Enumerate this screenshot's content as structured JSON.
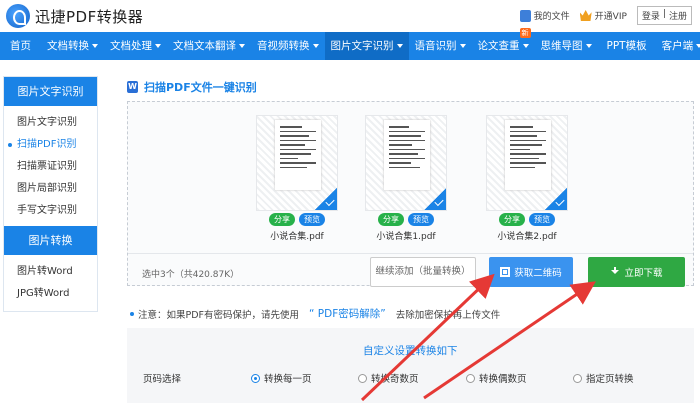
{
  "header": {
    "brand": "迅捷PDF转换器",
    "my_files": "我的文件",
    "open_vip": "开通VIP",
    "login": "登录",
    "separator": "|",
    "register": "注册"
  },
  "nav": {
    "items": [
      {
        "label": "首页"
      },
      {
        "label": "文档转换"
      },
      {
        "label": "文档处理"
      },
      {
        "label": "文档文本翻译"
      },
      {
        "label": "音视频转换"
      },
      {
        "label": "图片文字识别"
      },
      {
        "label": "语音识别"
      },
      {
        "label": "论文查重"
      },
      {
        "label": "思维导图"
      },
      {
        "label": "PPT模板"
      },
      {
        "label": "客户端"
      }
    ],
    "new_badge": "新"
  },
  "sidebar": {
    "group1_title": "图片文字识别",
    "group1_items": [
      "图片文字识别",
      "扫描PDF识别",
      "扫描票证识别",
      "图片局部识别",
      "手写文字识别"
    ],
    "group2_title": "图片转换",
    "group2_items": [
      "图片转Word",
      "JPG转Word"
    ]
  },
  "main": {
    "title": "扫描PDF文件一键识别",
    "title_icon": "W",
    "files": [
      {
        "name": "小说合集.pdf",
        "share": "分享",
        "preview": "预览"
      },
      {
        "name": "小说合集1.pdf",
        "share": "分享",
        "preview": "预览"
      },
      {
        "name": "小说合集2.pdf",
        "share": "分享",
        "preview": "预览"
      }
    ],
    "selected_text": "选中3个（共420.87K）",
    "continue_add": "继续添加（批量转换）",
    "get_qr": "获取二维码",
    "download": "立即下载"
  },
  "notice": {
    "prefix": "注意：如果PDF有密码保护，请先使用",
    "link": "“ PDF密码解除”",
    "suffix": "去除加密保护再上传文件"
  },
  "settings": {
    "title": "自定义设置转换如下",
    "page_label": "页码选择",
    "options": [
      "转换每一页",
      "转换奇数页",
      "转换偶数页",
      "指定页转换"
    ],
    "selected_index": 0
  },
  "colors": {
    "primary": "#1a83e6",
    "download_green": "#2fa843",
    "arrow_red": "#e53935"
  }
}
